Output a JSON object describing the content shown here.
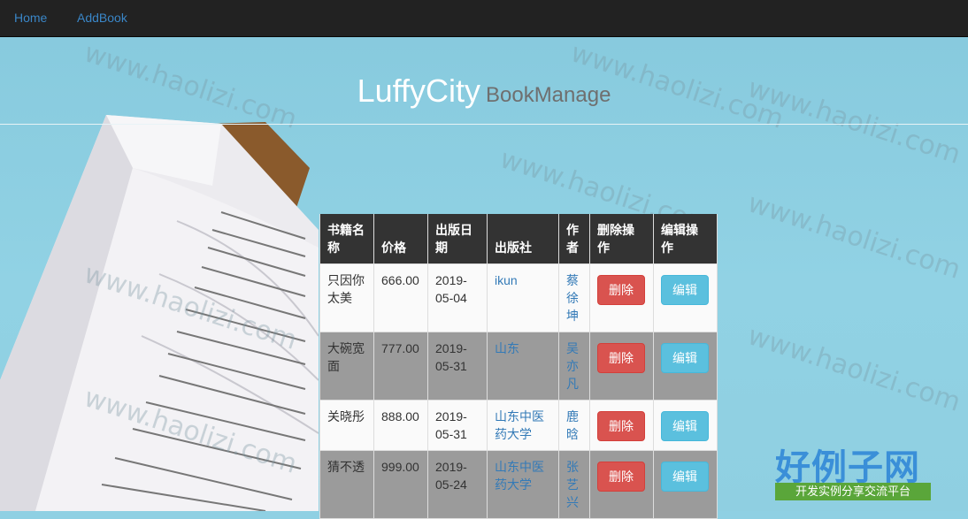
{
  "nav": {
    "home": "Home",
    "addbook": "AddBook"
  },
  "brand": {
    "title": "LuffyCity",
    "subtitle": "BookManage"
  },
  "table": {
    "headers": [
      "书籍名称",
      "价格",
      "出版日期",
      "出版社",
      "作者",
      "删除操作",
      "编辑操作"
    ],
    "rows": [
      {
        "name": "只因你太美",
        "price": "666.00",
        "date": "2019-05-04",
        "publisher": "ikun",
        "author": "蔡徐坤",
        "delete": "删除",
        "edit": "编辑"
      },
      {
        "name": "大碗宽面",
        "price": "777.00",
        "date": "2019-05-31",
        "publisher": "山东",
        "author": "吴亦凡",
        "delete": "删除",
        "edit": "编辑"
      },
      {
        "name": "关晓彤",
        "price": "888.00",
        "date": "2019-05-31",
        "publisher": "山东中医药大学",
        "author": "鹿晗",
        "delete": "删除",
        "edit": "编辑"
      },
      {
        "name": "猜不透",
        "price": "999.00",
        "date": "2019-05-24",
        "publisher": "山东中医药大学",
        "author": "张艺兴",
        "delete": "删除",
        "edit": "编辑"
      }
    ]
  },
  "watermark": "www.haolizi.com",
  "site_logo": {
    "title": "好例子网",
    "tagline": "开发实例分享交流平台"
  },
  "colors": {
    "navbar": "#222222",
    "link": "#337ab7",
    "danger": "#d9534f",
    "info": "#5bc0de",
    "header_cell": "#333333"
  },
  "icons": [
    "open-book-image"
  ]
}
